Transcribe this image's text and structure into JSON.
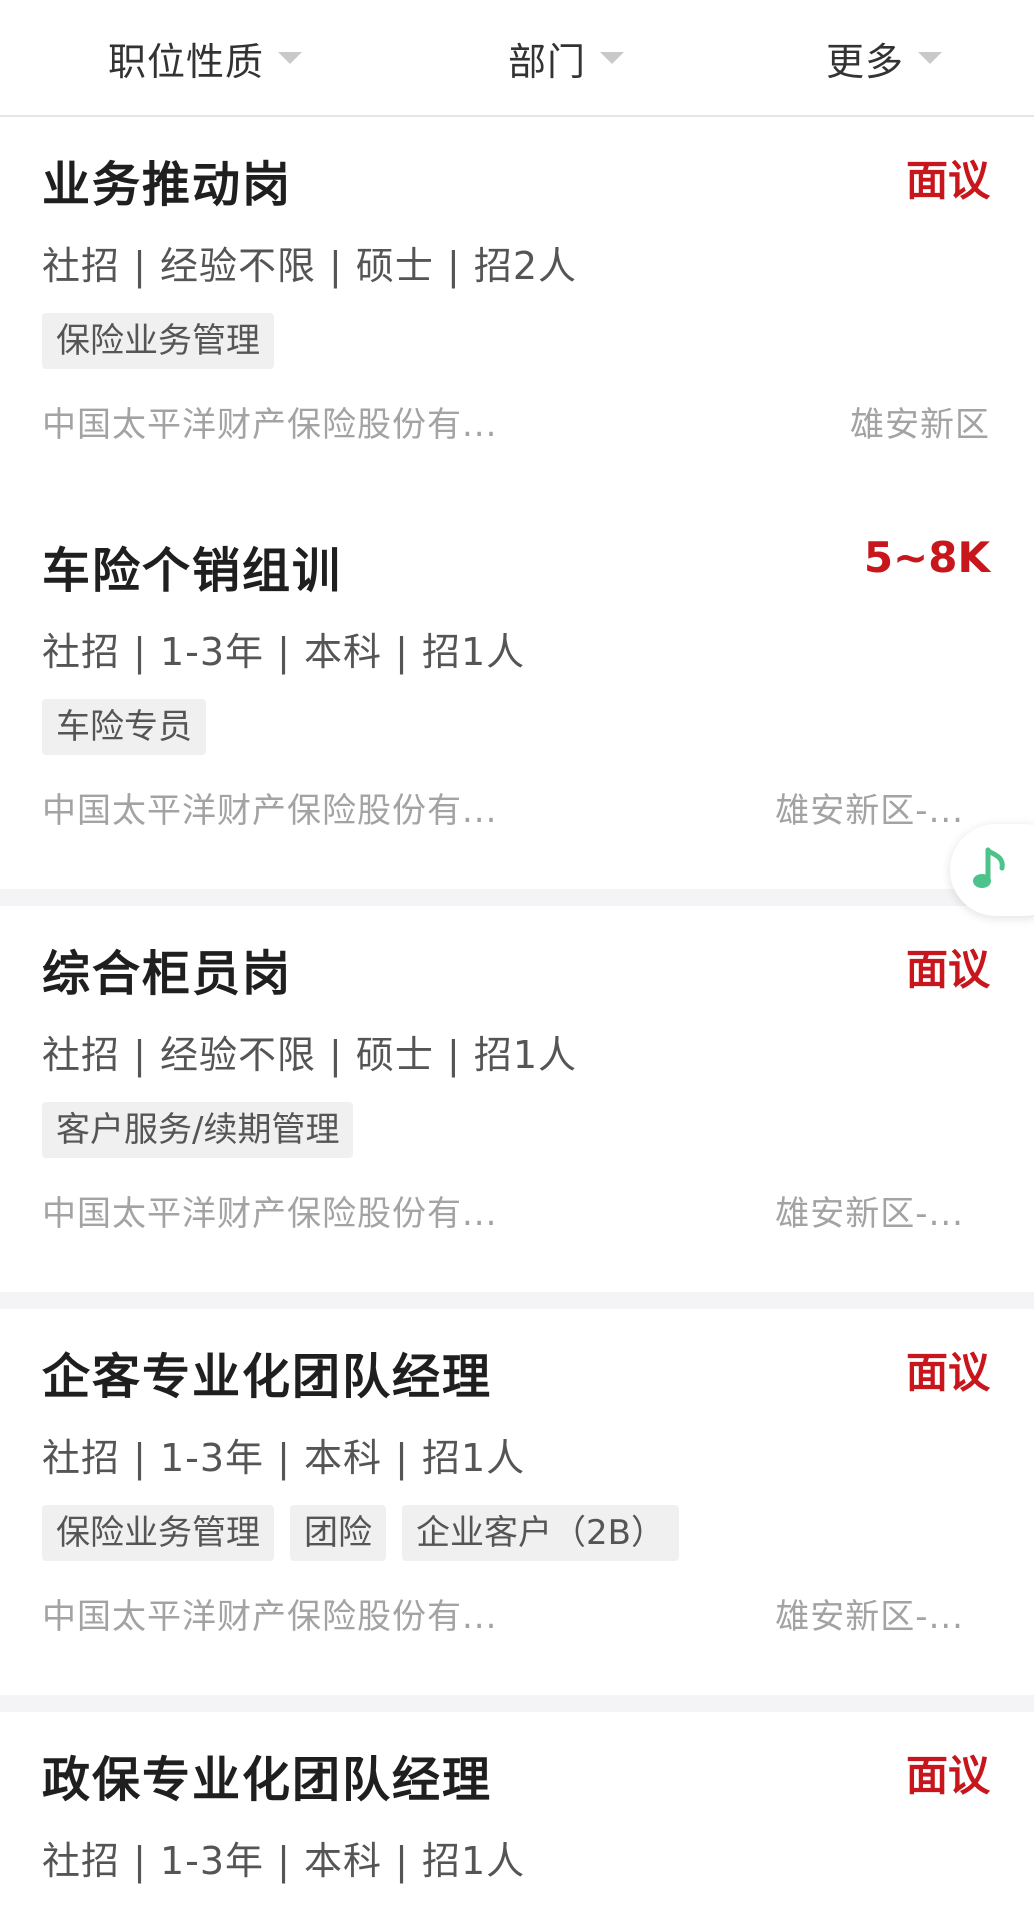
{
  "filters": {
    "type": "职位性质",
    "dept": "部门",
    "more": "更多"
  },
  "jobs": [
    {
      "title": "业务推动岗",
      "salary": "面议",
      "meta": "社招 | 经验不限 | 硕士 | 招2人",
      "tags": [
        "保险业务管理"
      ],
      "company": "中国太平洋财产保险股份有...",
      "location": "雄安新区"
    },
    {
      "title": "车险个销组训",
      "salary": "5~8K",
      "meta": "社招 | 1-3年 | 本科 | 招1人",
      "tags": [
        "车险专员"
      ],
      "company": "中国太平洋财产保险股份有...",
      "location": "雄安新区-..."
    },
    {
      "title": "综合柜员岗",
      "salary": "面议",
      "meta": "社招 | 经验不限 | 硕士 | 招1人",
      "tags": [
        "客户服务/续期管理"
      ],
      "company": "中国太平洋财产保险股份有...",
      "location": "雄安新区-..."
    },
    {
      "title": "企客专业化团队经理",
      "salary": "面议",
      "meta": "社招 | 1-3年 | 本科 | 招1人",
      "tags": [
        "保险业务管理",
        "团险",
        "企业客户（2B）"
      ],
      "company": "中国太平洋财产保险股份有...",
      "location": "雄安新区-..."
    },
    {
      "title": "政保专业化团队经理",
      "salary": "面议",
      "meta": "社招 | 1-3年 | 本科 | 招1人"
    }
  ],
  "floating": {
    "icon": "music-note-icon",
    "color": "#4cc38a"
  },
  "colors": {
    "salary": "#c8161d",
    "muted": "#a3a3a3",
    "tag_bg": "#f0f0f0"
  }
}
